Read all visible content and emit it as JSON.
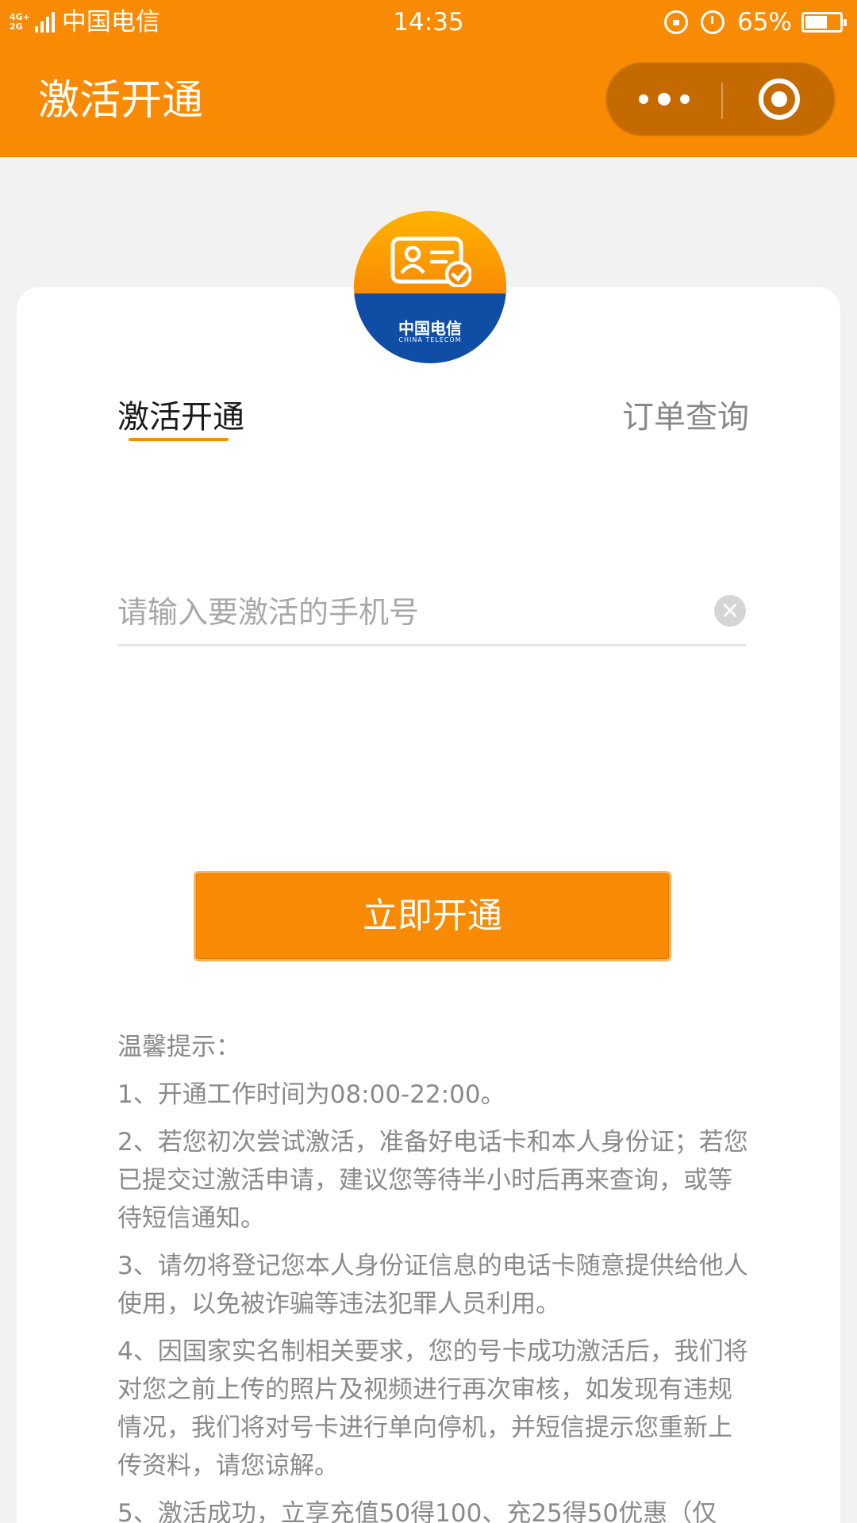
{
  "status_bar": {
    "network_type_top": "4G+",
    "network_type_bottom": "2G",
    "carrier": "中国电信",
    "time": "14:35",
    "battery_percent": "65%",
    "battery_level": 0.65,
    "icons": [
      "signal-icon",
      "rotation-lock-icon",
      "alarm-icon",
      "battery-icon"
    ]
  },
  "nav": {
    "title": "激活开通",
    "icons": [
      "more-dots-icon",
      "close-target-icon"
    ]
  },
  "logo": {
    "brand_cn": "中国电信",
    "brand_en": "CHINA TELECOM"
  },
  "tabs": [
    {
      "label": "激活开通",
      "active": true
    },
    {
      "label": "订单查询",
      "active": false
    }
  ],
  "form": {
    "phone_placeholder": "请输入要激活的手机号",
    "phone_value": "",
    "submit_label": "立即开通"
  },
  "tips": {
    "title": "温馨提示：",
    "items": [
      "1、开通工作时间为08:00-22:00。",
      "2、若您初次尝试激活，准备好电话卡和本人身份证；若您已提交过激活申请，建议您等待半小时后再来查询，或等待短信通知。",
      "3、请勿将登记您本人身份证信息的电话卡随意提供给他人使用，以免被诈骗等违法犯罪人员利用。",
      "4、因国家实名制相关要求，您的号卡成功激活后，我们将对您之前上传的照片及视频进行再次审核，如发现有违规情况，我们将对号卡进行单向停机，并短信提示您重新上传资料，请您谅解。",
      "5、激活成功，立享充值50得100、充25得50优惠（仅"
    ]
  },
  "colors": {
    "accent": "#f98b04",
    "accent_dark": "#c46a00",
    "logo_blue": "#0f4ea4",
    "text_muted": "#8a8a8a"
  }
}
